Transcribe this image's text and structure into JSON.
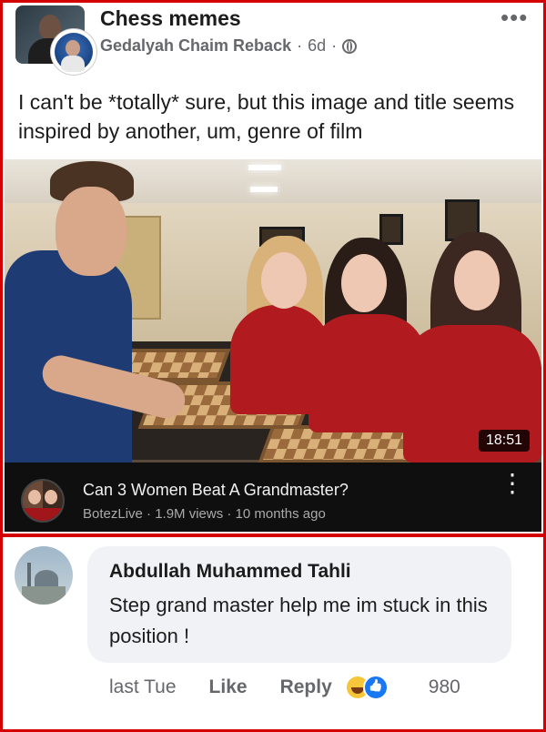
{
  "post": {
    "group_name": "Chess memes",
    "author": "Gedalyah Chaim Reback",
    "separator": "·",
    "time": "6d",
    "separator2": "·",
    "more": "•••",
    "text": "I can't be *totally* sure, but this image and title seems inspired by another, um, genre of film"
  },
  "video": {
    "duration": "18:51",
    "title": "Can 3 Women Beat A Grandmaster?",
    "meta": "BotezLive · 1.9M views · 10 months ago",
    "more": "⋮"
  },
  "comment": {
    "name": "Abdullah Muhammed Tahli",
    "text": "Step grand master help me im stuck in this position !",
    "time": "last Tue",
    "like_label": "Like",
    "reply_label": "Reply",
    "reaction_count": "980",
    "reactions": [
      "haha-icon",
      "like-icon"
    ]
  },
  "colors": {
    "frame_border": "#d40000",
    "link_meta": "#65676b",
    "bubble": "#f0f2f5",
    "yt_bar": "#0f0f0f"
  }
}
